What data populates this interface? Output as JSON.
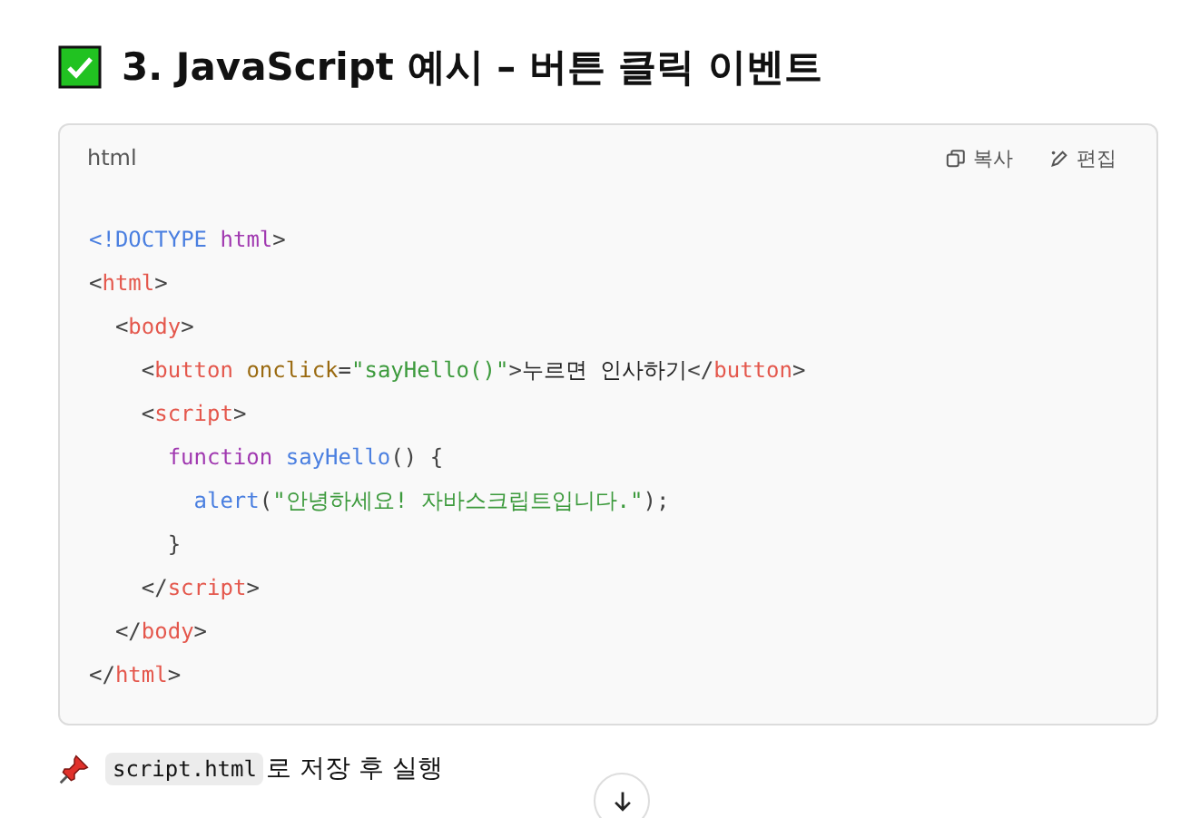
{
  "heading": {
    "text": "3. JavaScript 예시 – 버튼 클릭 이벤트"
  },
  "code_block": {
    "language": "html",
    "actions": [
      {
        "kind": "copy",
        "label": "복사"
      },
      {
        "kind": "edit",
        "label": "편집"
      }
    ],
    "lines": [
      {
        "tokens": [
          {
            "kind": "doctype",
            "text": "<!DOCTYPE "
          },
          {
            "kind": "keyword",
            "text": "html"
          },
          {
            "kind": "bracket",
            "text": ">"
          }
        ]
      },
      {
        "tokens": [
          {
            "kind": "bracket",
            "text": "<"
          },
          {
            "kind": "tag",
            "text": "html"
          },
          {
            "kind": "bracket",
            "text": ">"
          }
        ],
        "children": [
          {
            "tokens": [
              {
                "kind": "bracket",
                "text": "<"
              },
              {
                "kind": "tag",
                "text": "body"
              },
              {
                "kind": "bracket",
                "text": ">"
              }
            ],
            "children": [
              {
                "tokens": [
                  {
                    "kind": "bracket",
                    "text": "<"
                  },
                  {
                    "kind": "tag",
                    "text": "button"
                  },
                  {
                    "kind": "attr",
                    "text": " onclick"
                  },
                  {
                    "kind": "bracket",
                    "text": "="
                  },
                  {
                    "kind": "string",
                    "text": "\"sayHello()\""
                  },
                  {
                    "kind": "bracket",
                    "text": ">"
                  },
                  {
                    "kind": "plain",
                    "text": "누르면 인사하기"
                  },
                  {
                    "kind": "bracket",
                    "text": "</"
                  },
                  {
                    "kind": "tag",
                    "text": "button"
                  },
                  {
                    "kind": "bracket",
                    "text": ">"
                  }
                ]
              },
              {
                "tokens": [
                  {
                    "kind": "bracket",
                    "text": "<"
                  },
                  {
                    "kind": "tag",
                    "text": "script"
                  },
                  {
                    "kind": "bracket",
                    "text": ">"
                  }
                ],
                "children": [
                  {
                    "tokens": [
                      {
                        "kind": "keyword",
                        "text": "function "
                      },
                      {
                        "kind": "function",
                        "text": "sayHello"
                      },
                      {
                        "kind": "bracket",
                        "text": "() {"
                      }
                    ],
                    "children": [
                      {
                        "tokens": [
                          {
                            "kind": "function",
                            "text": "alert"
                          },
                          {
                            "kind": "bracket",
                            "text": "("
                          },
                          {
                            "kind": "string",
                            "text": "\"안녕하세요! 자바스크립트입니다.\""
                          },
                          {
                            "kind": "bracket",
                            "text": ");"
                          }
                        ]
                      }
                    ]
                  },
                  {
                    "tokens": [
                      {
                        "kind": "bracket",
                        "text": "}"
                      }
                    ]
                  }
                ]
              },
              {
                "tokens": [
                  {
                    "kind": "bracket",
                    "text": "</"
                  },
                  {
                    "kind": "tag",
                    "text": "script"
                  },
                  {
                    "kind": "bracket",
                    "text": ">"
                  }
                ]
              }
            ]
          },
          {
            "tokens": [
              {
                "kind": "bracket",
                "text": "</"
              },
              {
                "kind": "tag",
                "text": "body"
              },
              {
                "kind": "bracket",
                "text": ">"
              }
            ]
          }
        ]
      },
      {
        "tokens": [
          {
            "kind": "bracket",
            "text": "</"
          },
          {
            "kind": "tag",
            "text": "html"
          },
          {
            "kind": "bracket",
            "text": ">"
          }
        ]
      }
    ]
  },
  "note": {
    "code": "script.html",
    "text": "로 저장 후 실행"
  }
}
